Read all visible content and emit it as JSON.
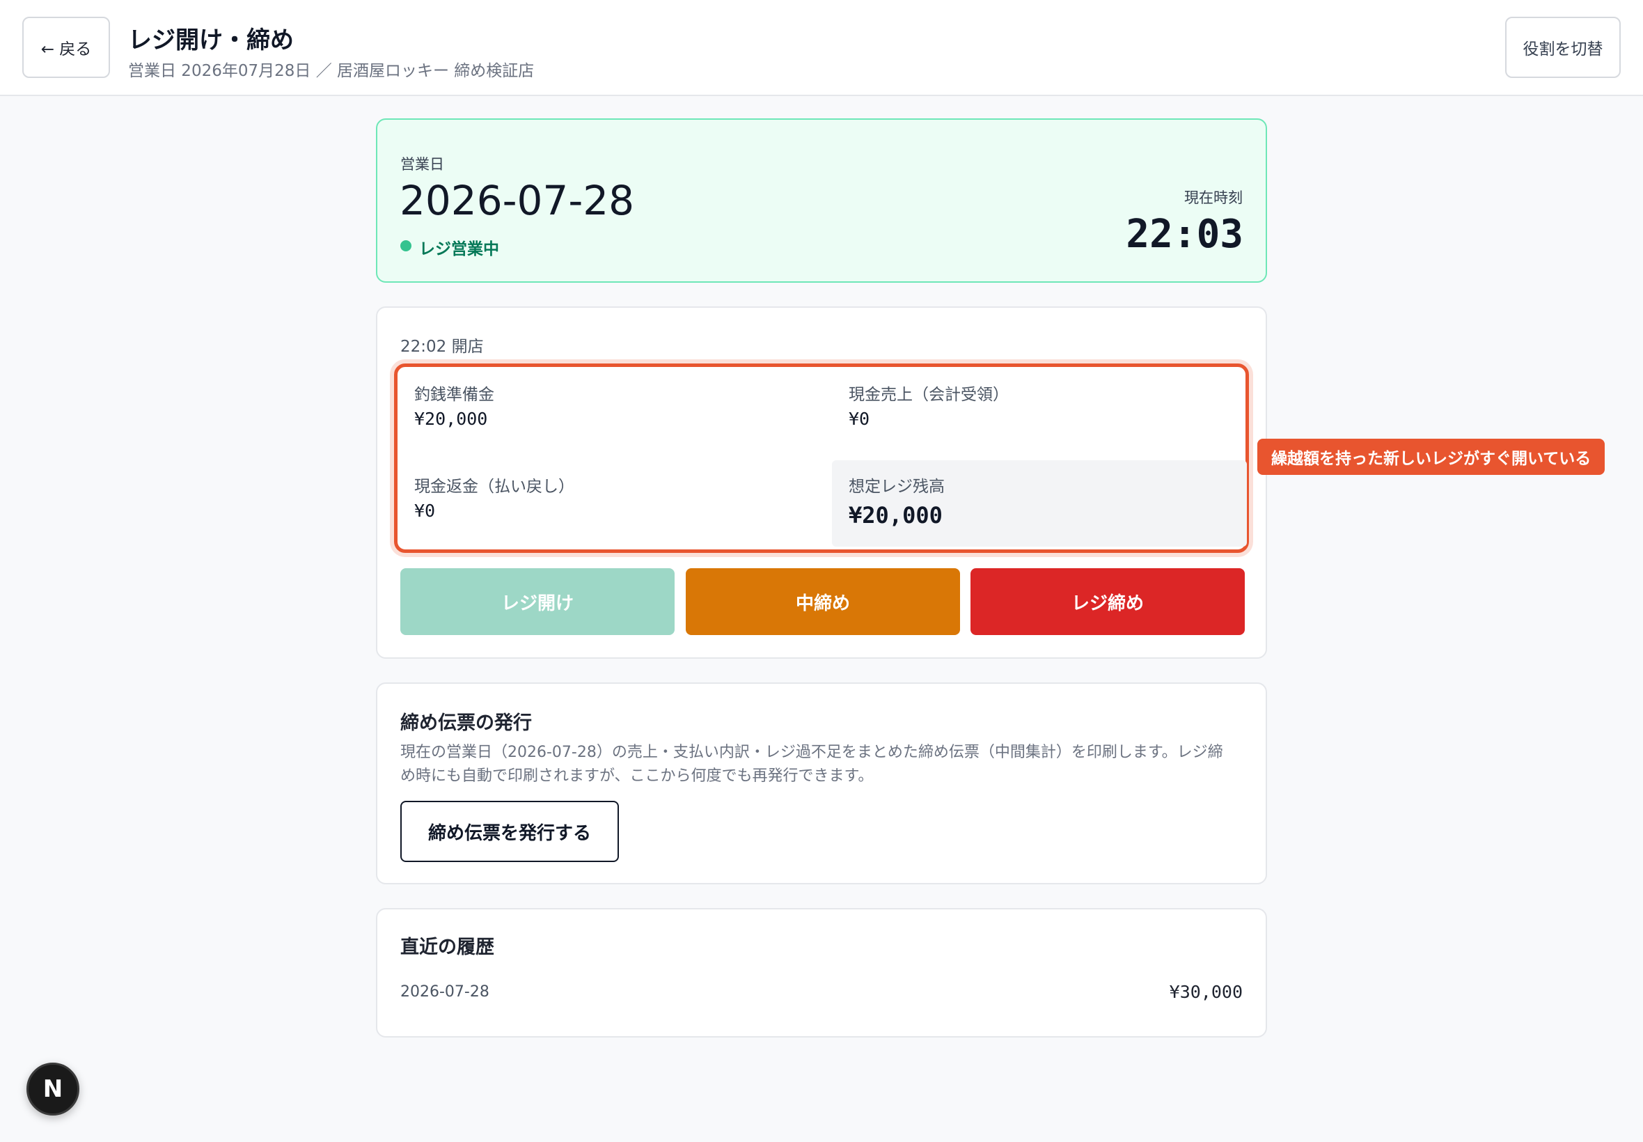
{
  "header": {
    "back_label": "← 戻る",
    "title": "レジ開け・締め",
    "subtitle": "営業日 2026年07月28日 ／ 居酒屋ロッキー 締め検証店",
    "role_switch_label": "役割を切替"
  },
  "status": {
    "business_day_label": "営業日",
    "business_day_value": "2026-07-28",
    "register_status": "レジ営業中",
    "current_time_label": "現在時刻",
    "current_time_value": "22:03",
    "status_color": "#34c38f"
  },
  "register": {
    "open_time": "22:02 開店",
    "change_fund_label": "釣銭準備金",
    "change_fund_value": "¥20,000",
    "cash_sales_label": "現金売上（会計受領）",
    "cash_sales_value": "¥0",
    "cash_refund_label": "現金返金（払い戻し）",
    "cash_refund_value": "¥0",
    "expected_balance_label": "想定レジ残高",
    "expected_balance_value": "¥20,000",
    "callout": "繰越額を持った新しいレジがすぐ開いている",
    "buttons": {
      "open": "レジ開け",
      "mid_close": "中締め",
      "close": "レジ締め"
    },
    "colors": {
      "open": "#9dd7c6",
      "mid_close": "#d97706",
      "close": "#dc2626",
      "highlight": "#e8552f"
    }
  },
  "slip": {
    "title": "締め伝票の発行",
    "description": "現在の営業日（2026-07-28）の売上・支払い内訳・レジ過不足をまとめた締め伝票（中間集計）を印刷します。レジ締め時にも自動で印刷されますが、ここから何度でも再発行できます。",
    "button_label": "締め伝票を発行する"
  },
  "history": {
    "title": "直近の履歴",
    "rows": [
      {
        "date": "2026-07-28",
        "amount": "¥30,000"
      }
    ]
  },
  "devtools_badge": "N"
}
